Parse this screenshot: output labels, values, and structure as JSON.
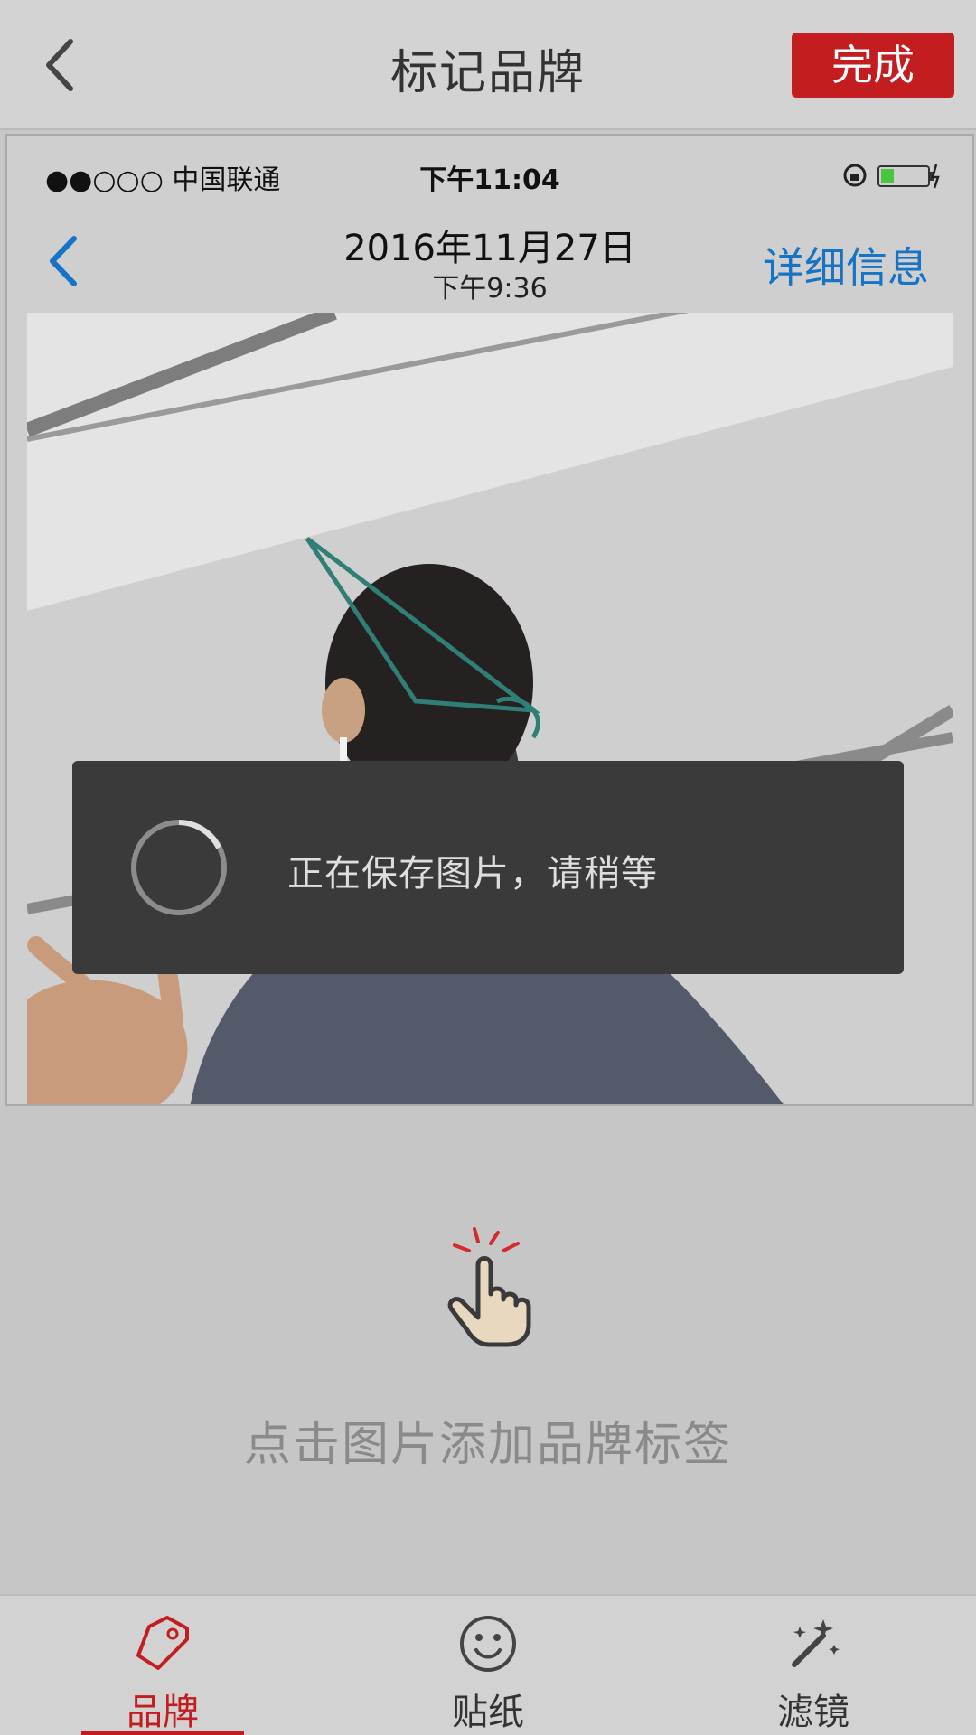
{
  "header": {
    "title": "标记品牌",
    "done_label": "完成"
  },
  "inner_screenshot": {
    "carrier": "●●○○○ 中国联通",
    "time": "下午11:04",
    "date": "2016年11月27日",
    "subtime": "下午9:36",
    "detail_label": "详细信息"
  },
  "toast": {
    "message": "正在保存图片，请稍等"
  },
  "hint": {
    "text": "点击图片添加品牌标签"
  },
  "tabs": [
    {
      "label": "品牌",
      "icon": "tag-icon",
      "active": true
    },
    {
      "label": "贴纸",
      "icon": "smiley-icon",
      "active": false
    },
    {
      "label": "滤镜",
      "icon": "magic-wand-icon",
      "active": false
    }
  ],
  "colors": {
    "accent": "#c41d20",
    "link_blue": "#1673c6",
    "toast_bg": "#3a3a3a"
  }
}
